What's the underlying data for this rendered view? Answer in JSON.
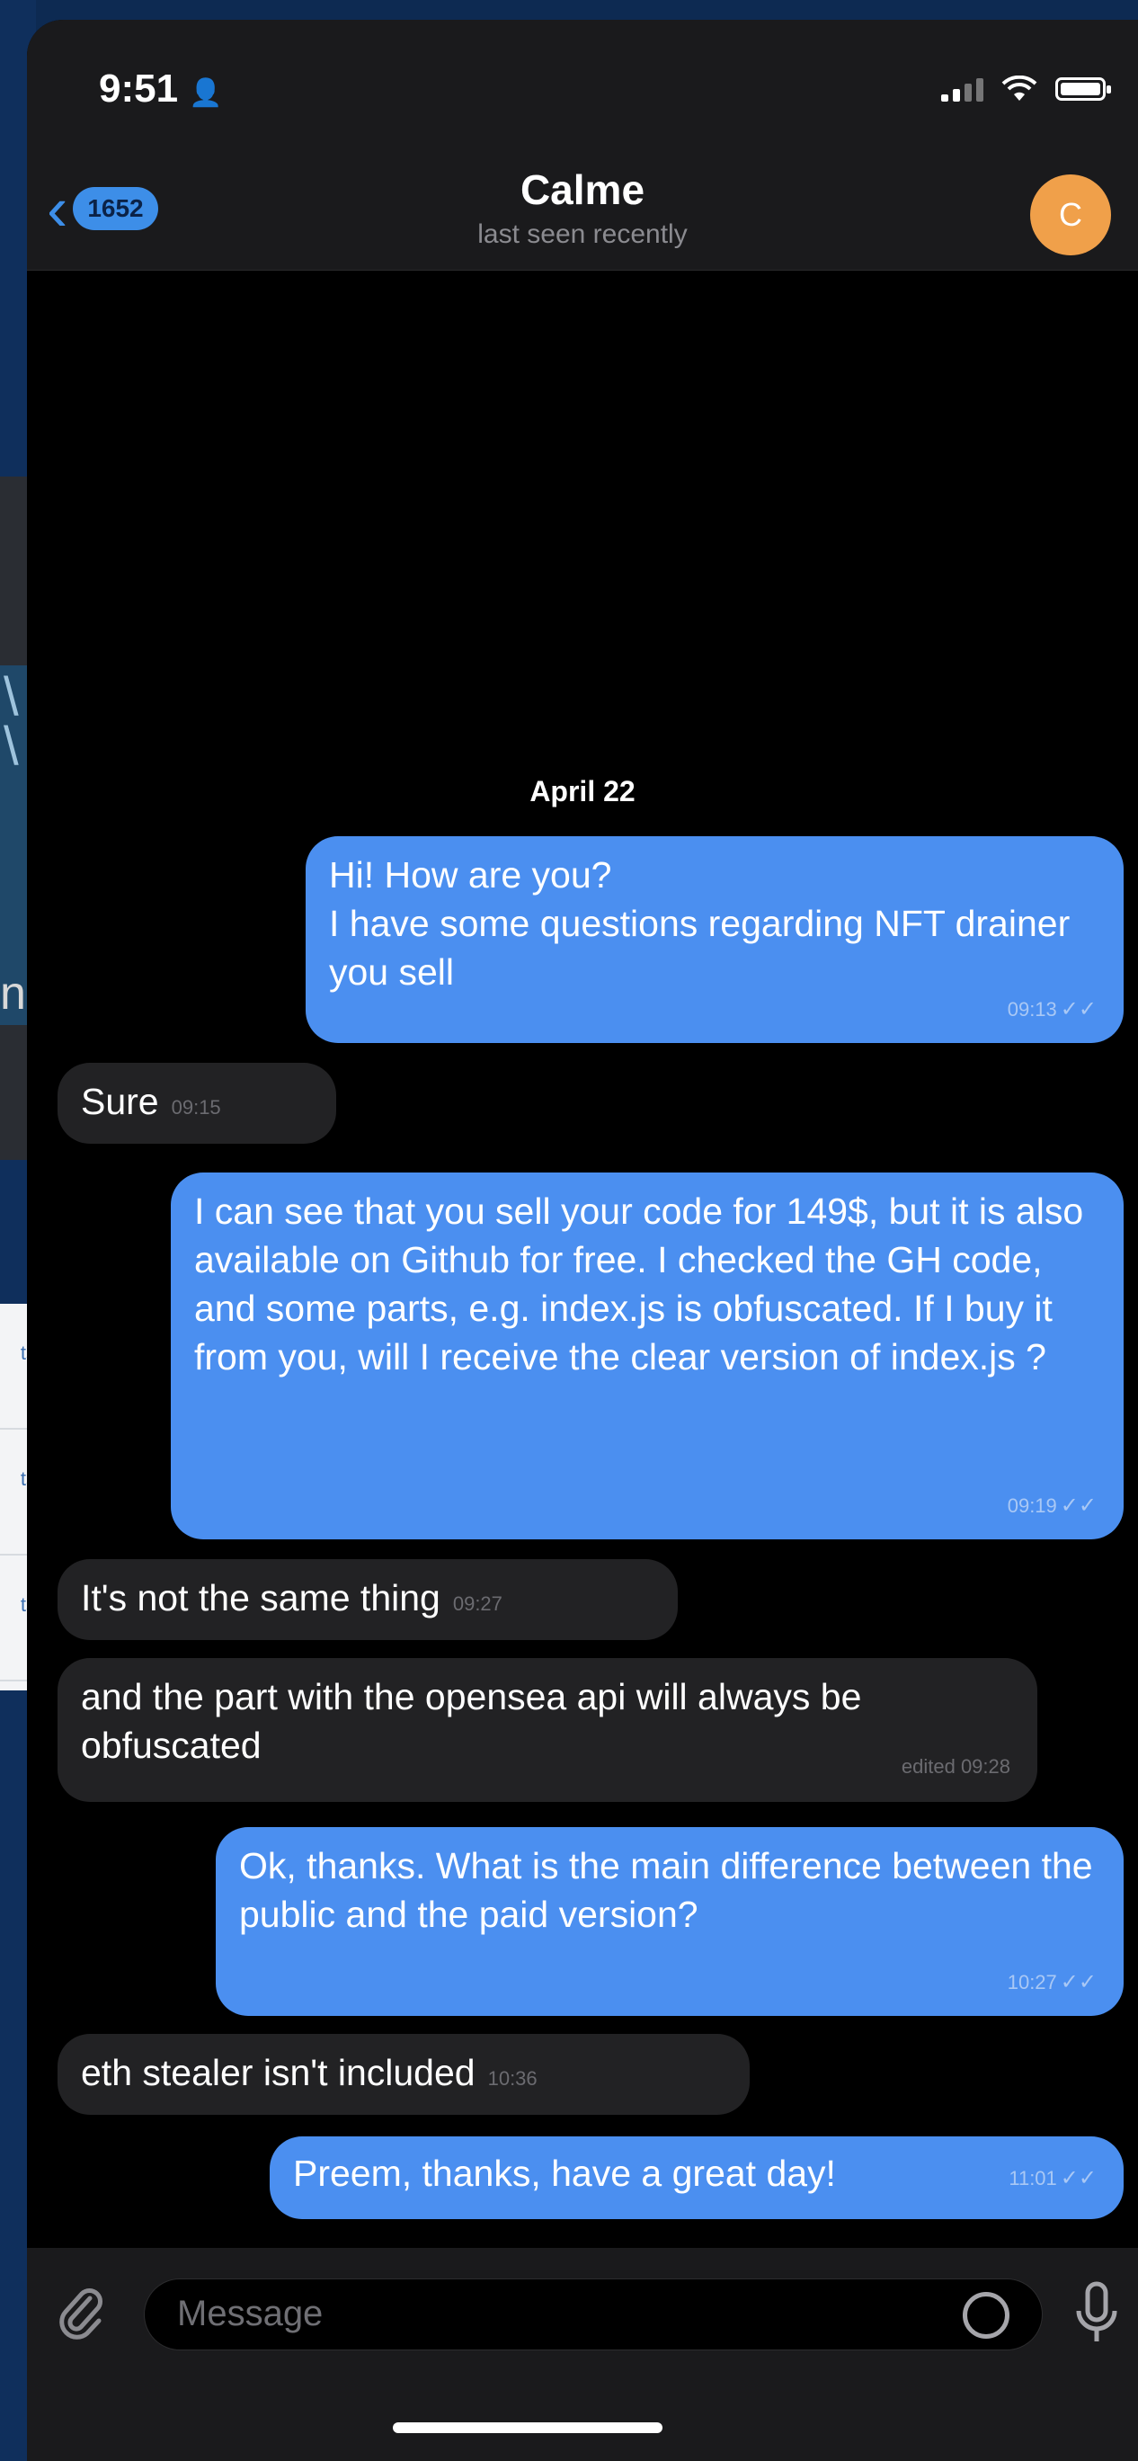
{
  "status": {
    "time": "9:51"
  },
  "header": {
    "back_badge": "1652",
    "title": "Calme",
    "subtitle": "last seen recently",
    "avatar_initial": "C"
  },
  "chat": {
    "date": "April 22",
    "messages": [
      {
        "dir": "out",
        "text": "Hi! How are you?\nI have some questions regarding NFT drainer you sell",
        "time": "09:13"
      },
      {
        "dir": "in",
        "text": "Sure",
        "time": "09:15"
      },
      {
        "dir": "out",
        "text": "I can see that you sell your code for 149$, but it is also available on Github for free. I checked the GH code, and some parts, e.g. index.js is obfuscated. If I buy it from you, will I receive the clear version of index.js ?",
        "time": "09:19"
      },
      {
        "dir": "in",
        "text": "It's not the same thing",
        "time": "09:27"
      },
      {
        "dir": "in",
        "text": "and the part with the opensea api will always be obfuscated",
        "time": "edited 09:28"
      },
      {
        "dir": "out",
        "text": "Ok, thanks. What is the main difference between the public and the paid version?",
        "time": "10:27"
      },
      {
        "dir": "in",
        "text": "eth stealer isn't included",
        "time": "10:36"
      },
      {
        "dir": "out",
        "text": "Preem, thanks, have a great day!",
        "time": "11:01"
      }
    ]
  },
  "composer": {
    "placeholder": "Message"
  },
  "background": {
    "tab_labels": [
      "ts",
      "ts",
      "ts"
    ],
    "letter": "n"
  }
}
